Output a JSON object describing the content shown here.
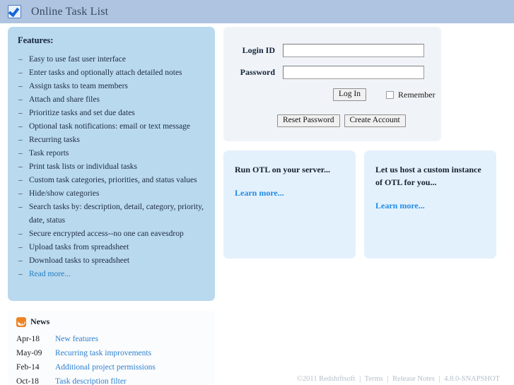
{
  "header": {
    "title": "Online Task List",
    "logo_icon": "checkbox-check-icon"
  },
  "features": {
    "title": "Features:",
    "bullet": "–",
    "items": [
      "Easy to use fast user interface",
      "Enter tasks and optionally attach detailed notes",
      "Assign tasks to team members",
      "Attach and share files",
      "Prioritize tasks and set due dates",
      "Optional task notifications: email or text message",
      "Recurring tasks",
      "Task reports",
      "Print task lists or individual tasks",
      "Custom task categories, priorities, and status values",
      "Hide/show categories",
      "Search tasks by: description, detail, category, priority, date, status",
      "Secure encrypted access--no one can eavesdrop",
      "Upload tasks from spreadsheet",
      "Download tasks to spreadsheet"
    ],
    "read_more": "Read more..."
  },
  "news": {
    "title": "News",
    "rss_icon": "rss-feed-icon",
    "entries": [
      {
        "date": "Apr-18",
        "title": "New features"
      },
      {
        "date": "May-09",
        "title": "Recurring task improvements"
      },
      {
        "date": "Feb-14",
        "title": "Additional project permissions"
      },
      {
        "date": "Oct-18",
        "title": "Task description filter"
      }
    ]
  },
  "login": {
    "login_id_label": "Login ID",
    "login_id_value": "",
    "password_label": "Password",
    "password_value": "",
    "login_button": "Log In",
    "remember_label": "Remember",
    "remember_checked": false,
    "reset_password_button": "Reset Password",
    "create_account_button": "Create Account"
  },
  "promos": [
    {
      "heading": "Run OTL on your server...",
      "link": "Learn more..."
    },
    {
      "heading": "Let us host a custom instance of OTL for you...",
      "link": "Learn more..."
    }
  ],
  "footer": {
    "copyright": "©2011 Redshiftsoft",
    "terms": "Terms",
    "release_notes": "Release Notes",
    "version": "4.8.0-SNAPSHOT",
    "separator": "|"
  },
  "colors": {
    "header_bg": "#aec4e0",
    "features_bg": "#b9d9ee",
    "login_bg": "#f0f4f8",
    "promo_bg": "#e3f1fd",
    "link": "#1f7ec7",
    "rss_orange": "#ee8324"
  }
}
